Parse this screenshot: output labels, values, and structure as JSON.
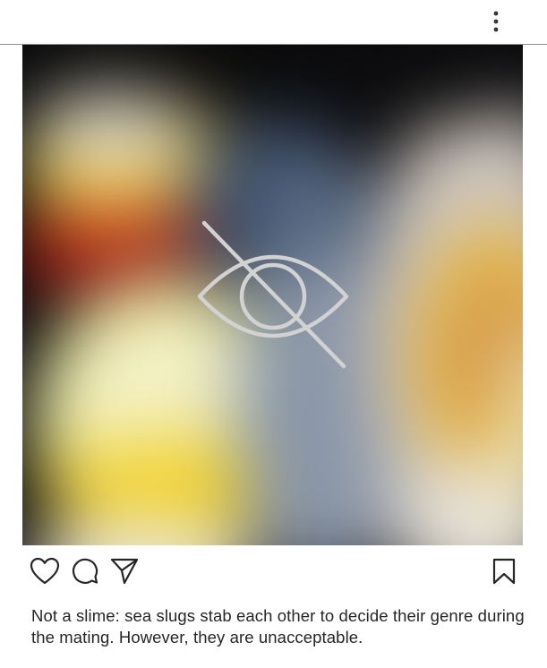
{
  "header": {
    "more_icon": "more-vertical-icon"
  },
  "media": {
    "overlay_icon": "eye-off-icon",
    "colors": {
      "background": "#0b0b0d",
      "overlay_stroke": "#d2d2d2"
    }
  },
  "actions": {
    "like_icon": "heart-icon",
    "comment_icon": "comment-icon",
    "share_icon": "send-icon",
    "save_icon": "bookmark-icon"
  },
  "post": {
    "caption": "Not a slime: sea slugs stab each other to decide their genre during the mating. However, they are unacceptable."
  }
}
